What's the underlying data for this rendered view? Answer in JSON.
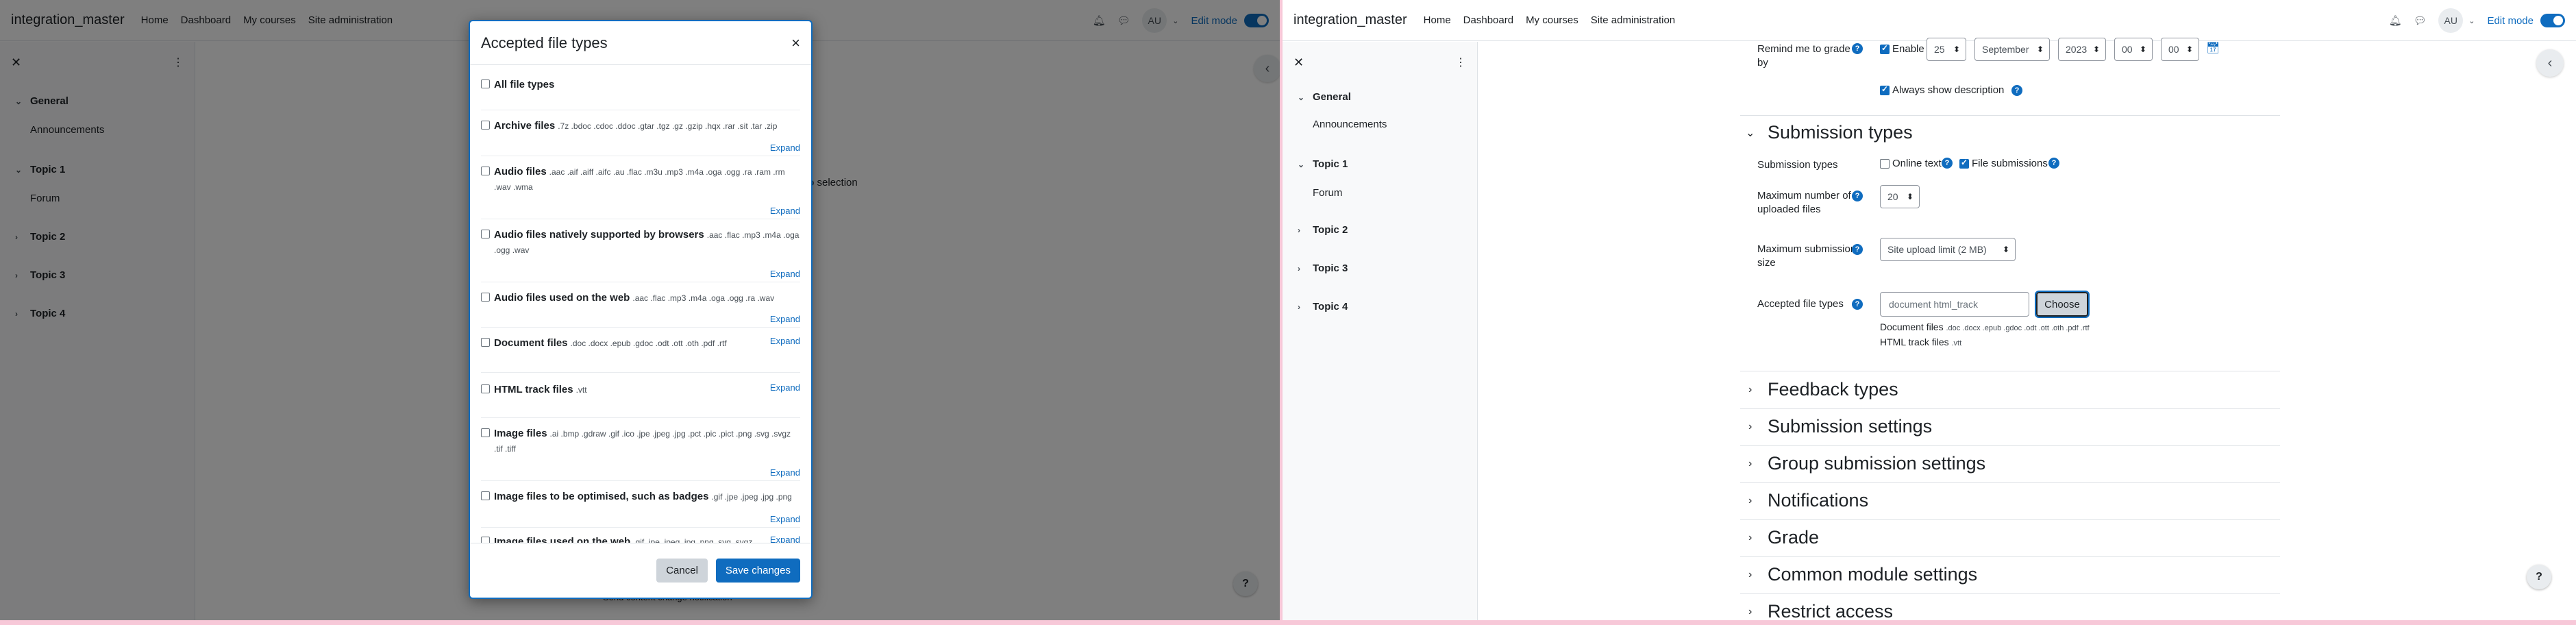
{
  "navbar": {
    "site_name": "integration_master",
    "links": [
      "Home",
      "Dashboard",
      "My courses",
      "Site administration"
    ],
    "avatar": "AU",
    "edit_mode_label": "Edit mode"
  },
  "drawer": {
    "sections": [
      {
        "title": "General",
        "items": [
          "Announcements"
        ]
      },
      {
        "title": "Topic 1",
        "items": [
          "Forum"
        ]
      },
      {
        "title": "Topic 2",
        "items": []
      },
      {
        "title": "Topic 3",
        "items": []
      },
      {
        "title": "Topic 4",
        "items": []
      }
    ]
  },
  "left_background": {
    "partial_text": "o selection",
    "footer_partial": "Send content change notification"
  },
  "modal": {
    "title": "Accepted file types",
    "file_types": [
      {
        "name": "All file types",
        "extensions": "",
        "expand": ""
      },
      {
        "name": "Archive files",
        "extensions": ".7z .bdoc .cdoc .ddoc .gtar .tgz .gz .gzip .hqx .rar .sit .tar .zip",
        "expand": "Expand"
      },
      {
        "name": "Audio files",
        "extensions": ".aac .aif .aiff .aifc .au .flac .m3u .mp3 .m4a .oga .ogg .ra .ram .rm .wav .wma",
        "expand": "Expand"
      },
      {
        "name": "Audio files natively supported by browsers",
        "extensions": ".aac .flac .mp3 .m4a .oga .ogg .wav",
        "expand": "Expand"
      },
      {
        "name": "Audio files used on the web",
        "extensions": ".aac .flac .mp3 .m4a .oga .ogg .ra .wav",
        "expand": "Expand"
      },
      {
        "name": "Document files",
        "extensions": ".doc .docx .epub .gdoc .odt .ott .oth .pdf .rtf",
        "expand": "Expand"
      },
      {
        "name": "HTML track files",
        "extensions": ".vtt",
        "expand": "Expand"
      },
      {
        "name": "Image files",
        "extensions": ".ai .bmp .gdraw .gif .ico .jpe .jpeg .jpg .pct .pic .pict .png .svg .svgz .tif .tiff",
        "expand": "Expand"
      },
      {
        "name": "Image files to be optimised, such as badges",
        "extensions": ".gif .jpe .jpeg .jpg .png",
        "expand": "Expand"
      },
      {
        "name": "Image files used on the web",
        "extensions": ".gif .jpe .jpeg .jpg .png .svg .svgz",
        "expand": "Expand"
      }
    ],
    "cancel_label": "Cancel",
    "save_label": "Save changes"
  },
  "form": {
    "remind_label": "Remind me to grade by",
    "enable_label": "Enable",
    "day": "25",
    "month": "September",
    "year": "2023",
    "hour": "00",
    "minute": "00",
    "always_show_label": "Always show description",
    "submission_types_header": "Submission types",
    "submission_types_label": "Submission types",
    "online_text_label": "Online text",
    "file_submissions_label": "File submissions",
    "max_files_label": "Maximum number of uploaded files",
    "max_files_value": "20",
    "max_size_label": "Maximum submission size",
    "max_size_value": "Site upload limit (2 MB)",
    "accepted_label": "Accepted file types",
    "accepted_value": "document html_track",
    "choose_label": "Choose",
    "accepted_summary": [
      {
        "name": "Document files",
        "extensions": ".doc .docx .epub .gdoc .odt .ott .oth .pdf .rtf"
      },
      {
        "name": "HTML track files",
        "extensions": ".vtt"
      }
    ],
    "collapsed_sections": [
      "Feedback types",
      "Submission settings",
      "Group submission settings",
      "Notifications",
      "Grade",
      "Common module settings",
      "Restrict access"
    ]
  },
  "colors": {
    "primary": "#0f6cbf",
    "overlay": "rgba(0,0,0,0.5)",
    "frame": "#f7c8d8"
  }
}
